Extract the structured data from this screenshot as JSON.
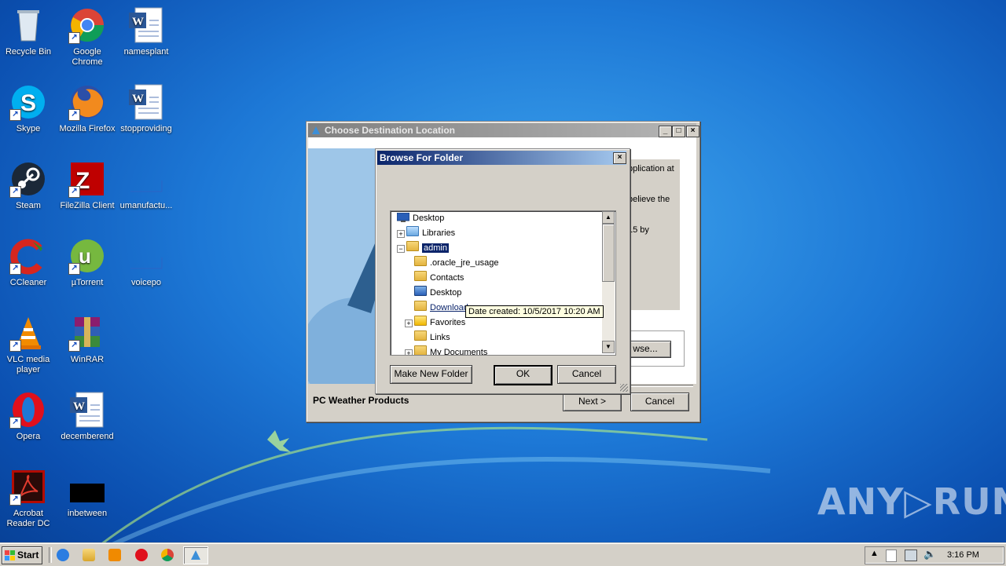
{
  "desktop": {
    "icons": [
      {
        "label": "Recycle Bin"
      },
      {
        "label": "Google\nChrome"
      },
      {
        "label": "namesplant"
      },
      {
        "label": "Skype"
      },
      {
        "label": "Mozilla Firefox"
      },
      {
        "label": "stopproviding"
      },
      {
        "label": "Steam"
      },
      {
        "label": "FileZilla Client"
      },
      {
        "label": "umanufactu..."
      },
      {
        "label": "CCleaner"
      },
      {
        "label": "µTorrent"
      },
      {
        "label": "voicepo"
      },
      {
        "label": "VLC media\nplayer"
      },
      {
        "label": "WinRAR"
      },
      {
        "label": "Opera"
      },
      {
        "label": "decemberend"
      },
      {
        "label": "Acrobat\nReader DC"
      },
      {
        "label": "inbetween"
      }
    ]
  },
  "installer": {
    "title": "Choose Destination Location",
    "text_fragments": [
      "pplication at",
      "believe the",
      "15 by"
    ],
    "browse_label": "wse...",
    "brand": "PC Weather Products",
    "next_label": "Next >",
    "cancel_label": "Cancel"
  },
  "browse_dialog": {
    "title": "Browse For Folder",
    "tree": [
      {
        "label": "Desktop"
      },
      {
        "label": "Libraries",
        "expander": "+"
      },
      {
        "label": "admin",
        "expander": "−"
      },
      {
        "label": ".oracle_jre_usage"
      },
      {
        "label": "Contacts"
      },
      {
        "label": "Desktop"
      },
      {
        "label": "Download"
      },
      {
        "label": "Favorites",
        "expander": "+"
      },
      {
        "label": "Links"
      },
      {
        "label": "My Documents",
        "expander": "+"
      }
    ],
    "tooltip": "Date created: 10/5/2017 10:20 AM",
    "make_new_folder_label": "Make New Folder",
    "ok_label": "OK",
    "cancel_label": "Cancel"
  },
  "taskbar": {
    "start_label": "Start",
    "clock": "3:16 PM"
  },
  "watermark": "ANY▷RUN"
}
